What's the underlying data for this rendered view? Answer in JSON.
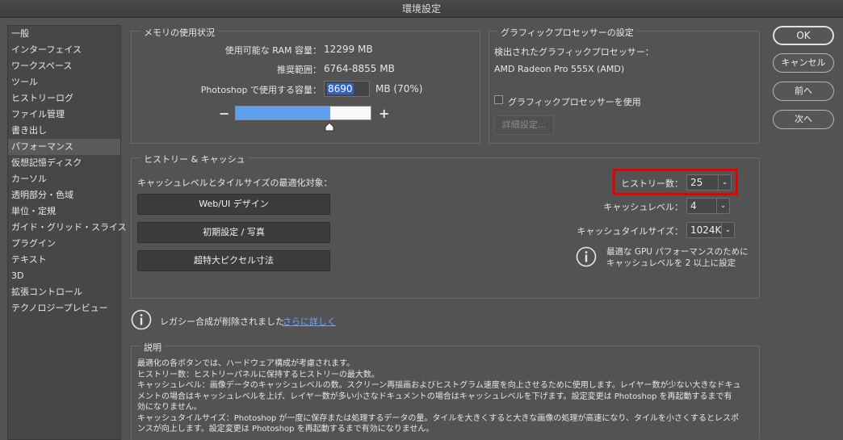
{
  "window": {
    "title": "環境設定"
  },
  "sidebar": {
    "items": [
      {
        "label": "一般"
      },
      {
        "label": "インターフェイス"
      },
      {
        "label": "ワークスペース"
      },
      {
        "label": "ツール"
      },
      {
        "label": "ヒストリーログ"
      },
      {
        "label": "ファイル管理"
      },
      {
        "label": "書き出し"
      },
      {
        "label": "パフォーマンス",
        "selected": true
      },
      {
        "label": "仮想記憶ディスク"
      },
      {
        "label": "カーソル"
      },
      {
        "label": "透明部分・色域"
      },
      {
        "label": "単位・定規"
      },
      {
        "label": "ガイド・グリッド・スライス"
      },
      {
        "label": "プラグイン"
      },
      {
        "label": "テキスト"
      },
      {
        "label": "3D"
      },
      {
        "label": "拡張コントロール"
      },
      {
        "label": "テクノロジープレビュー"
      }
    ]
  },
  "memory": {
    "title": "メモリの使用状況",
    "available_label": "使用可能な RAM 容量：",
    "available_value": "12299 MB",
    "range_label": "推奨範囲：",
    "range_value": "6764-8855 MB",
    "use_label": "Photoshop で使用する容量：",
    "use_value": "8690",
    "use_suffix": "MB (70%)",
    "slider_percent": 70,
    "minus": "−",
    "plus": "+"
  },
  "gpu": {
    "title": "グラフィックプロセッサーの設定",
    "detected_label": "検出されたグラフィックプロセッサー：",
    "detected_value": "AMD Radeon Pro 555X (AMD)",
    "use_checkbox_label": "グラフィックプロセッサーを使用",
    "use_checked": false,
    "advanced_button": "詳細設定..."
  },
  "history_cache": {
    "title": "ヒストリー & キャッシュ",
    "optimize_label": "キャッシュレベルとタイルサイズの最適化対象：",
    "buttons": [
      "Web/UI デザイン",
      "初期設定 / 写真",
      "超特大ピクセル寸法"
    ],
    "history_states_label": "ヒストリー数：",
    "history_states_value": "25",
    "cache_levels_label": "キャッシュレベル：",
    "cache_levels_value": "4",
    "tile_size_label": "キャッシュタイルサイズ：",
    "tile_size_value": "1024K",
    "gpu_tip_line1": "最適な GPU パフォーマンスのために",
    "gpu_tip_line2": "キャッシュレベルを 2 以上に設定"
  },
  "legacy": {
    "message": "レガシー合成が削除されました",
    "link": "さらに詳しく"
  },
  "description": {
    "title": "説明",
    "lines": [
      "最適化の各ボタンでは、ハードウェア構成が考慮されます。",
      "ヒストリー数：ヒストリーパネルに保持するヒストリーの最大数。",
      "キャッシュレベル：画像データのキャッシュレベルの数。スクリーン再描画およびヒストグラム速度を向上させるために使用します。レイヤー数が少ない大きなドキュ",
      "メントの場合はキャッシュレベルを上げ、レイヤー数が多い小さなドキュメントの場合はキャッシュレベルを下げます。設定変更は Photoshop を再起動するまで有",
      "効になりません。",
      "キャッシュタイルサイズ：Photoshop が一度に保存または処理するデータの量。タイルを大きくすると大きな画像の処理が高速になり、タイルを小さくするとレスポ",
      "ンスが向上します。設定変更は Photoshop を再起動するまで有効になりません。"
    ]
  },
  "actions": {
    "ok": "OK",
    "cancel": "キャンセル",
    "prev": "前へ",
    "next": "次へ"
  },
  "colors": {
    "highlight": "#e60000",
    "slider_fill": "#5fa0ee",
    "link": "#6ea7ff"
  }
}
